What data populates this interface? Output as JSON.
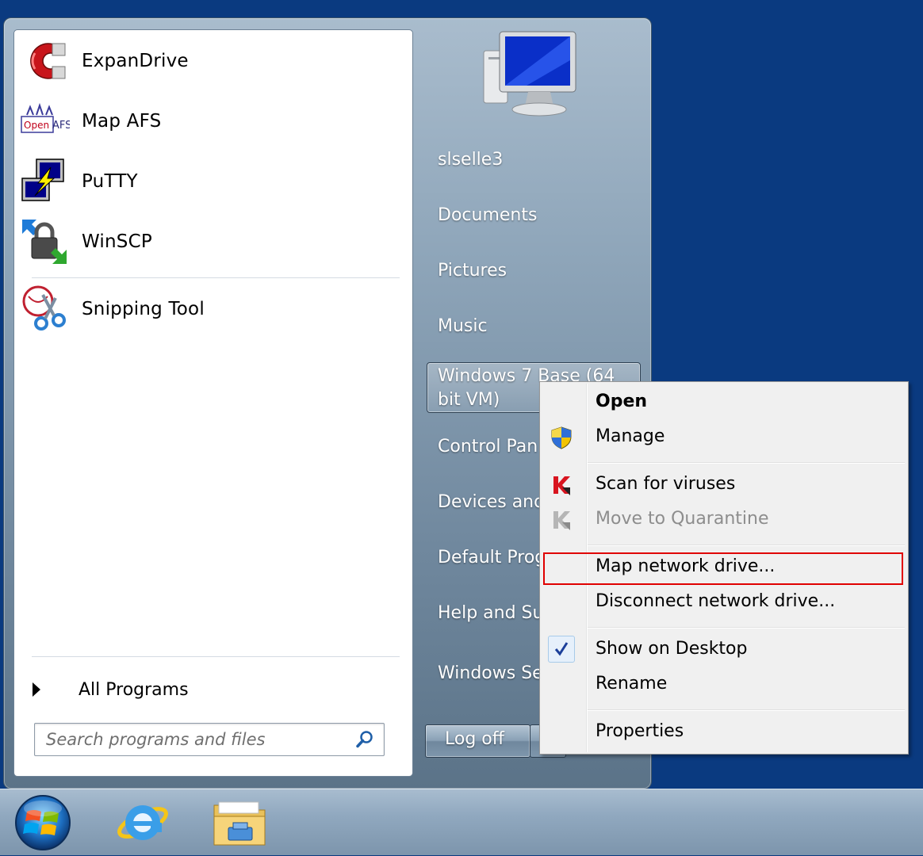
{
  "start_menu": {
    "pinned_programs": [
      {
        "label": "ExpanDrive",
        "icon": "expandrive-magnet-icon"
      },
      {
        "label": "Map AFS",
        "icon": "openafs-icon"
      },
      {
        "label": "PuTTY",
        "icon": "putty-icon"
      },
      {
        "label": "WinSCP",
        "icon": "winscp-icon"
      }
    ],
    "recent_programs": [
      {
        "label": "Snipping Tool",
        "icon": "snipping-tool-icon"
      }
    ],
    "all_programs_label": "All Programs",
    "search": {
      "placeholder": "Search programs and files",
      "value": ""
    },
    "right_pane": {
      "username": "slselle3",
      "items": [
        "Documents",
        "Pictures",
        "Music"
      ],
      "computer_item": "Windows 7 Base (64 bit VM)",
      "items_lower": [
        "Control Pan",
        "Devices and",
        "Default Prog",
        "Help and Su",
        "Windows Se"
      ]
    },
    "logoff_label": "Log off"
  },
  "context_menu": {
    "items": [
      {
        "label": "Open",
        "bold": true
      },
      {
        "label": "Manage",
        "icon": "uac-shield-icon"
      },
      {
        "label": "Scan for viruses",
        "icon": "kaspersky-icon"
      },
      {
        "label": "Move to Quarantine",
        "icon": "kaspersky-gray-icon",
        "disabled": true
      },
      {
        "label": "Map network drive...",
        "highlighted": true
      },
      {
        "label": "Disconnect network drive..."
      },
      {
        "label": "Show on Desktop",
        "checked": true
      },
      {
        "label": "Rename"
      },
      {
        "label": "Properties"
      }
    ]
  },
  "taskbar": {
    "items": [
      "start-orb",
      "internet-explorer-icon",
      "windows-explorer-icon"
    ]
  },
  "colors": {
    "desktop": "#0a3a80",
    "highlight_border": "#e00000"
  }
}
